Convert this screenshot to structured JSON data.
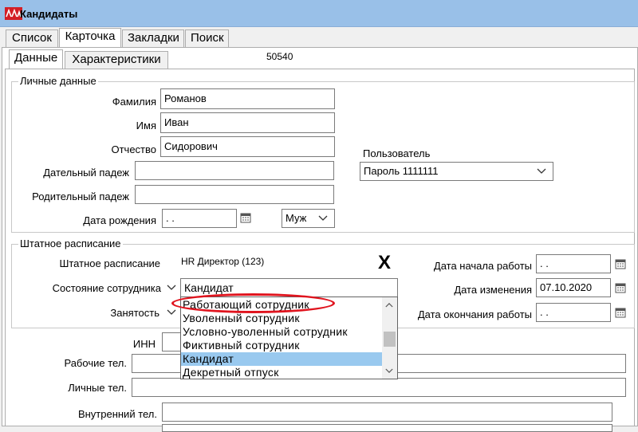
{
  "window": {
    "title": "Кандидаты",
    "icon": "app-logo-icon"
  },
  "tabs": [
    {
      "label": "Список"
    },
    {
      "label": "Карточка"
    },
    {
      "label": "Закладки"
    },
    {
      "label": "Поиск"
    }
  ],
  "subtabs": [
    {
      "label": "Данные"
    },
    {
      "label": "Характеристики"
    }
  ],
  "record_id": "50540",
  "personal": {
    "group_title": "Личные данные",
    "last_name_label": "Фамилия",
    "last_name": "Романов",
    "first_name_label": "Имя",
    "first_name": "Иван",
    "patronymic_label": "Отчество",
    "patronymic": "Сидорович",
    "dative_label": "Дательный падеж",
    "dative": "",
    "genitive_label": "Родительный падеж",
    "genitive": "",
    "birth_label": "Дата рождения",
    "birth_date": " .  .",
    "gender": "Муж",
    "user_label": "Пользователь",
    "user": "Пароль 1111111"
  },
  "staff": {
    "group_title": "Штатное расписание",
    "schedule_label": "Штатное расписание",
    "schedule_value": "HR Директор (123)",
    "mark": "X",
    "status_label": "Состояние сотрудника",
    "status_value": "Кандидат",
    "employment_label": "Занятость",
    "start_label": "Дата начала работы",
    "start_date": " .  .",
    "changed_label": "Дата изменения",
    "changed_date": "07.10.2020",
    "end_label": "Дата окончания работы",
    "end_date": " .  ."
  },
  "status_options": [
    "Работающий сотрудник",
    "Уволенный сотрудник",
    "Условно-уволенный сотрудник",
    "Фиктивный сотрудник",
    "Кандидат",
    "Декретный отпуск"
  ],
  "status_selected": "Кандидат",
  "contacts": {
    "inn_label": "ИНН",
    "inn": "",
    "work_phone_label": "Рабочие тел.",
    "work_phone": "",
    "personal_phone_label": "Личные тел.",
    "personal_phone": "",
    "internal_phone_label": "Внутренний тел.",
    "internal_phone": ""
  },
  "colors": {
    "titlebar": "#99c0e8",
    "selection": "#99c9ef",
    "annotation": "#e0141e"
  }
}
